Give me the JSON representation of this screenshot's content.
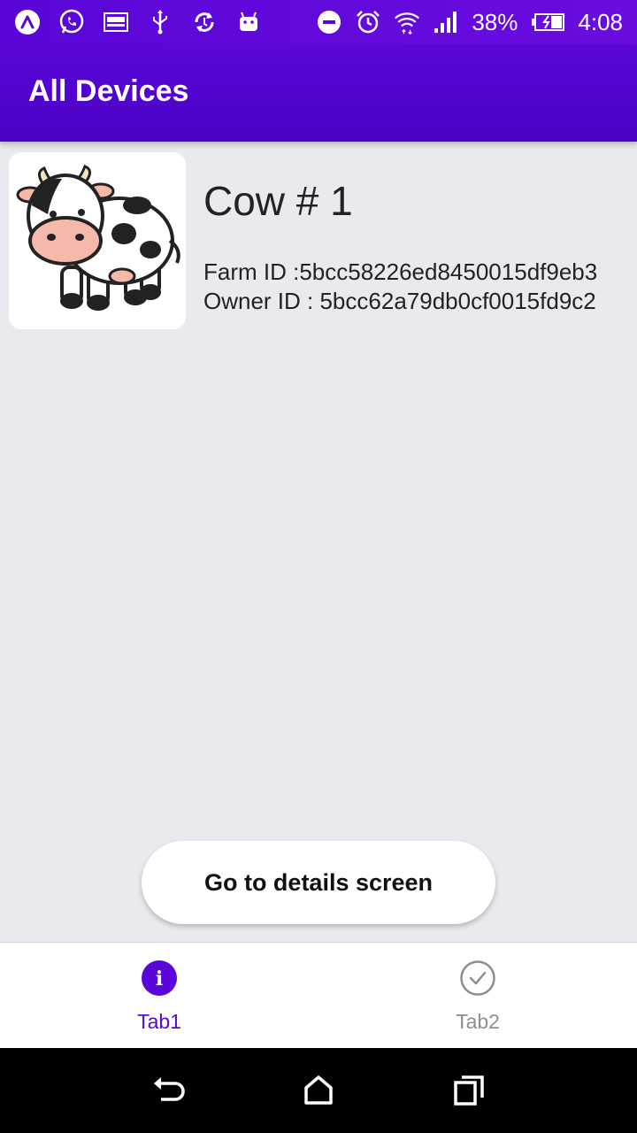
{
  "status_bar": {
    "battery_percent": "38%",
    "time": "4:08",
    "left_icons": [
      "expo-icon",
      "whatsapp-icon",
      "gallery-icon",
      "usb-icon",
      "sync-icon",
      "android-icon"
    ],
    "right_icons": [
      "do-not-disturb-icon",
      "alarm-icon",
      "wifi-icon",
      "signal-icon",
      "battery-icon"
    ]
  },
  "app_bar": {
    "title": "All Devices"
  },
  "device": {
    "name": "Cow # 1",
    "farm_id": "Farm ID :5bcc58226ed8450015df9eb3",
    "owner_id": "Owner ID : 5bcc62a79db0cf0015fd9c2",
    "image": "cow-illustration"
  },
  "details_button": {
    "label": "Go to details screen"
  },
  "tabs": [
    {
      "label": "Tab1",
      "icon": "info-icon",
      "active": true
    },
    {
      "label": "Tab2",
      "icon": "check-circle-icon",
      "active": false
    }
  ],
  "nav_bar": {
    "buttons": [
      "back-icon",
      "home-icon",
      "recents-icon"
    ]
  },
  "colors": {
    "primary": "#5a06d8",
    "background": "#e9e9ef",
    "tab_inactive": "#8e8e93"
  }
}
